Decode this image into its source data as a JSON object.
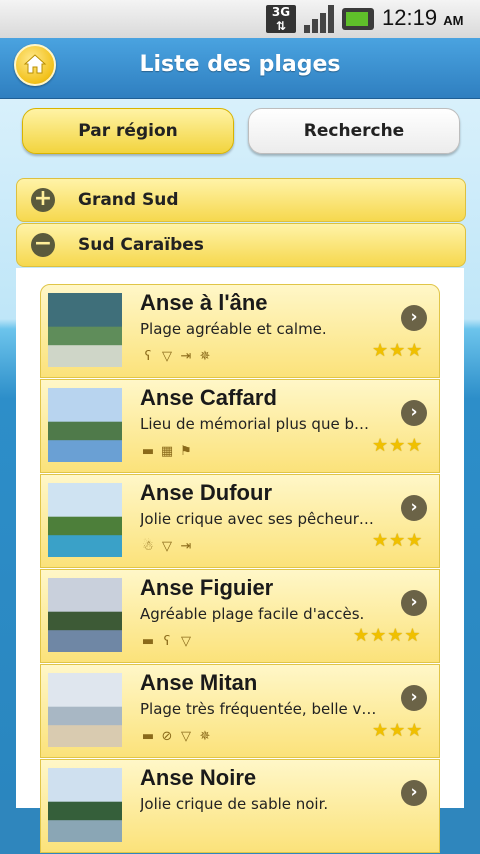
{
  "status_bar": {
    "network": "3G",
    "time": "12:19",
    "ampm": "AM"
  },
  "header": {
    "title": "Liste des plages",
    "home_icon": "home-icon"
  },
  "tabs": [
    {
      "label": "Par région",
      "active": true
    },
    {
      "label": "Recherche",
      "active": false
    }
  ],
  "groups": [
    {
      "label": "Grand Sud",
      "expanded": false
    },
    {
      "label": "Sud Caraïbes",
      "expanded": true
    }
  ],
  "beaches": [
    {
      "name": "Anse à l'âne",
      "desc": "Plage agréable et calme.",
      "icons": [
        "teddy-bear-icon",
        "ice-cream-icon",
        "signpost-icon",
        "helm-icon"
      ],
      "rating": 3,
      "colors": [
        "#3f6f7a",
        "#5f8d5a",
        "#cfd6c8"
      ]
    },
    {
      "name": "Anse Caffard",
      "desc": "Lieu de mémorial plus que b…",
      "icons": [
        "car-icon",
        "life-jacket-icon",
        "windsock-icon"
      ],
      "rating": 3,
      "colors": [
        "#b8d4ef",
        "#4f7a4a",
        "#6aa0d4"
      ]
    },
    {
      "name": "Anse Dufour",
      "desc": "Jolie crique avec ses pêcheur…",
      "icons": [
        "snorkel-icon",
        "ice-cream-icon",
        "signpost-icon"
      ],
      "rating": 3,
      "colors": [
        "#cfe3f2",
        "#4d7f3a",
        "#3aa1c8"
      ]
    },
    {
      "name": "Anse Figuier",
      "desc": "Agréable plage facile d'accès.",
      "icons": [
        "car-icon",
        "teddy-bear-icon",
        "ice-cream-icon"
      ],
      "rating": 4,
      "colors": [
        "#c9d0dc",
        "#3d5a36",
        "#6f87a5"
      ]
    },
    {
      "name": "Anse Mitan",
      "desc": "Plage très fréquentée, belle v…",
      "icons": [
        "car-icon",
        "restriction-icon",
        "ice-cream-icon",
        "helm-icon"
      ],
      "rating": 3,
      "colors": [
        "#dfe6ee",
        "#a8b7c4",
        "#d9cbb0"
      ]
    },
    {
      "name": "Anse Noire",
      "desc": "Jolie crique de sable noir.",
      "icons": [],
      "rating": 0,
      "colors": [
        "#cfe0ef",
        "#355f3a",
        "#8aa6b5"
      ]
    }
  ]
}
